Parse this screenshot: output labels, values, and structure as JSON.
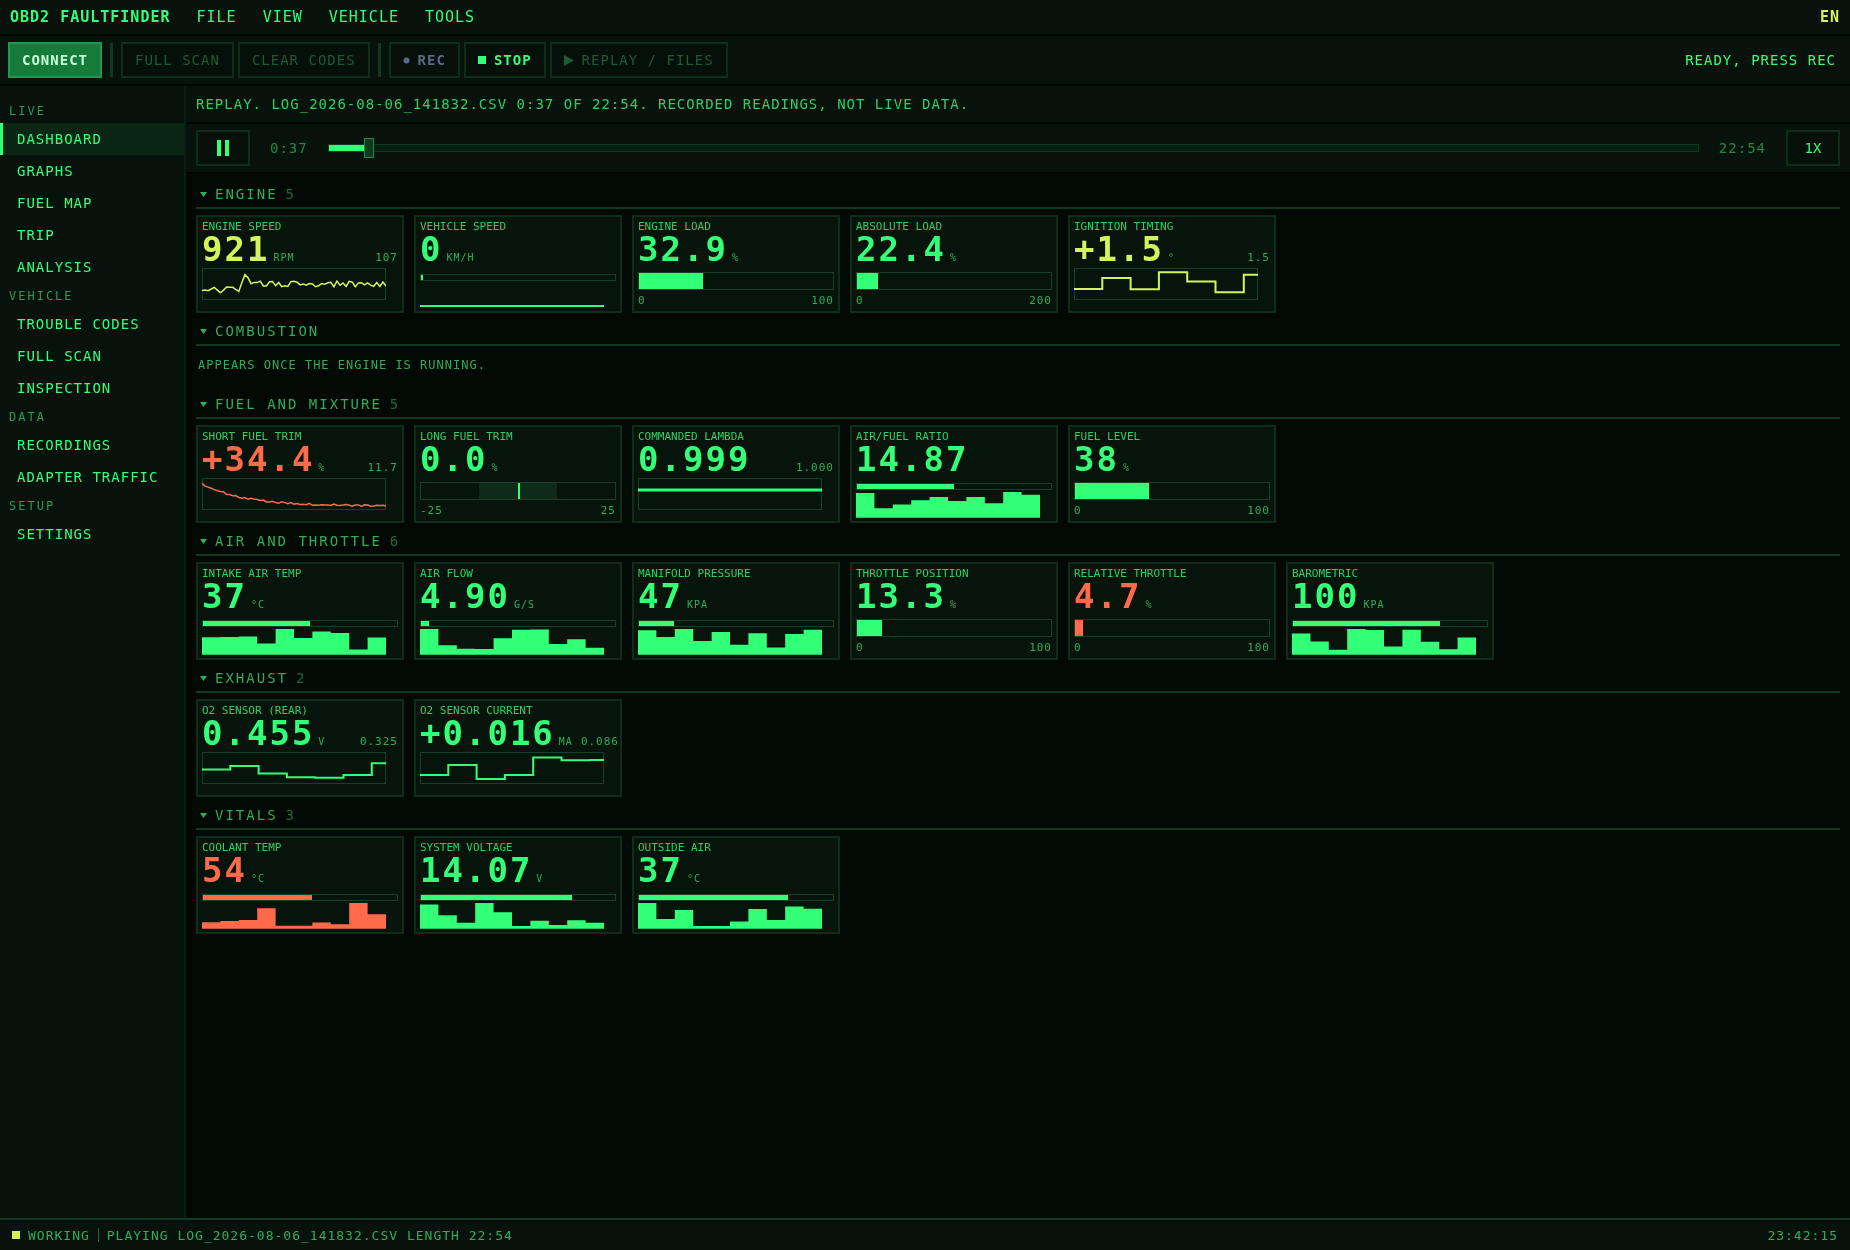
{
  "app": {
    "title": "OBD2 FAULTFINDER",
    "menu": [
      "FILE",
      "VIEW",
      "VEHICLE",
      "TOOLS"
    ],
    "language": "EN"
  },
  "toolbar": {
    "buttons": [
      {
        "label": "CONNECT",
        "kind": "primary",
        "disabled": false
      },
      {
        "label": "FULL SCAN",
        "kind": "plain",
        "disabled": true
      },
      {
        "label": "CLEAR CODES",
        "kind": "plain",
        "disabled": true
      },
      {
        "label": "REC",
        "kind": "record",
        "disabled": false
      },
      {
        "label": "STOP",
        "kind": "stop",
        "disabled": false
      },
      {
        "label": "REPLAY / FILES",
        "kind": "replay",
        "disabled": true
      }
    ],
    "status": "READY, PRESS REC"
  },
  "sidebar": [
    {
      "heading": "LIVE",
      "items": [
        {
          "label": "DASHBOARD",
          "selected": true
        },
        {
          "label": "GRAPHS",
          "selected": false
        },
        {
          "label": "FUEL MAP",
          "selected": false
        },
        {
          "label": "TRIP",
          "selected": false
        },
        {
          "label": "ANALYSIS",
          "selected": false
        }
      ]
    },
    {
      "heading": "VEHICLE",
      "items": [
        {
          "label": "TROUBLE CODES",
          "selected": false
        },
        {
          "label": "FULL SCAN",
          "selected": false
        },
        {
          "label": "INSPECTION",
          "selected": false
        }
      ]
    },
    {
      "heading": "DATA",
      "items": [
        {
          "label": "RECORDINGS",
          "selected": false
        },
        {
          "label": "ADAPTER TRAFFIC",
          "selected": false
        }
      ]
    },
    {
      "heading": "SETUP",
      "items": [
        {
          "label": "SETTINGS",
          "selected": false
        }
      ]
    }
  ],
  "replay": {
    "banner": "REPLAY. LOG_2026-08-06_141832.CSV 0:37 OF 22:54. RECORDED READINGS, NOT LIVE DATA.",
    "playing": true,
    "position": "0:37",
    "level": 0.03,
    "length": "22:54",
    "speed": "1X"
  },
  "sections": [
    {
      "title": "ENGINE",
      "count": "5",
      "expanded": true,
      "cards": [
        {
          "label": "ENGINE SPEED",
          "value": "921",
          "unit": "RPM",
          "color": "#d4f55a",
          "kind": "spark",
          "reading": "107"
        },
        {
          "label": "VEHICLE SPEED",
          "value": "0",
          "unit": "KM/H",
          "color": "#33ff77",
          "kind": "meter",
          "level": 0.01
        },
        {
          "label": "ENGINE LOAD",
          "value": "32.9",
          "unit": "%",
          "color": "#33ff77",
          "kind": "bar",
          "level": 0.33,
          "min": "0",
          "max": "100"
        },
        {
          "label": "ABSOLUTE LOAD",
          "value": "22.4",
          "unit": "%",
          "color": "#33ff77",
          "kind": "bar",
          "level": 0.11,
          "min": "0",
          "max": "200"
        },
        {
          "label": "IGNITION TIMING",
          "value": "+1.5",
          "unit": "°",
          "color": "#d4f55a",
          "kind": "step",
          "reading": "1.5"
        }
      ]
    },
    {
      "title": "COMBUSTION",
      "expanded": true,
      "note": "APPEARS ONCE THE ENGINE IS RUNNING."
    },
    {
      "title": "FUEL AND MIXTURE",
      "count": "5",
      "expanded": true,
      "cards": [
        {
          "label": "SHORT FUEL TRIM",
          "value": "+34.4",
          "unit": "%",
          "color": "#ff6b4a",
          "kind": "decay",
          "reading": "11.7"
        },
        {
          "label": "LONG FUEL TRIM",
          "value": "0.0",
          "unit": "%",
          "color": "#33ff77",
          "kind": "center",
          "level": 0.5,
          "min": "-25",
          "max": "25"
        },
        {
          "label": "COMMANDED LAMBDA",
          "value": "0.999",
          "color": "#33ff77",
          "kind": "flat",
          "reading": "1.000"
        },
        {
          "label": "AIR/FUEL RATIO",
          "value": "14.87",
          "color": "#33ff77",
          "kind": "meter",
          "level": 0.5
        },
        {
          "label": "FUEL LEVEL",
          "value": "38",
          "unit": "%",
          "color": "#33ff77",
          "kind": "bar",
          "level": 0.38,
          "min": "0",
          "max": "100"
        }
      ]
    },
    {
      "title": "AIR AND THROTTLE",
      "count": "6",
      "expanded": true,
      "cards": [
        {
          "label": "INTAKE AIR TEMP",
          "value": "37",
          "unit": "°C",
          "color": "#33ff77",
          "kind": "meter",
          "level": 0.55
        },
        {
          "label": "AIR FLOW",
          "value": "4.90",
          "unit": "G/S",
          "color": "#33ff77",
          "kind": "meter",
          "level": 0.04
        },
        {
          "label": "MANIFOLD PRESSURE",
          "value": "47",
          "unit": "KPA",
          "color": "#33ff77",
          "kind": "meter",
          "level": 0.18
        },
        {
          "label": "THROTTLE POSITION",
          "value": "13.3",
          "unit": "%",
          "color": "#33ff77",
          "kind": "bar",
          "level": 0.13,
          "min": "0",
          "max": "100"
        },
        {
          "label": "RELATIVE THROTTLE",
          "value": "4.7",
          "unit": "%",
          "color": "#ff6b4a",
          "kind": "bar",
          "level": 0.04,
          "min": "0",
          "max": "100"
        },
        {
          "label": "BAROMETRIC",
          "value": "100",
          "unit": "KPA",
          "color": "#33ff77",
          "kind": "meter",
          "level": 0.76
        }
      ]
    },
    {
      "title": "EXHAUST",
      "count": "2",
      "expanded": true,
      "cards": [
        {
          "label": "O2 SENSOR (REAR)",
          "value": "0.455",
          "unit": "V",
          "color": "#33ff77",
          "kind": "step",
          "reading": "0.325"
        },
        {
          "label": "O2 SENSOR CURRENT",
          "value": "+0.016",
          "unit": "MA",
          "color": "#33ff77",
          "kind": "step",
          "reading": "0.086"
        }
      ]
    },
    {
      "title": "VITALS",
      "count": "3",
      "expanded": true,
      "cards": [
        {
          "label": "COOLANT TEMP",
          "value": "54",
          "unit": "°C",
          "color": "#ff6b4a",
          "kind": "meter",
          "level": 0.56
        },
        {
          "label": "SYSTEM VOLTAGE",
          "value": "14.07",
          "unit": "V",
          "color": "#33ff77",
          "kind": "meter",
          "level": 0.78
        },
        {
          "label": "OUTSIDE AIR",
          "value": "37",
          "unit": "°C",
          "color": "#33ff77",
          "kind": "meter",
          "level": 0.77
        }
      ]
    }
  ],
  "status_bar": {
    "state": "WORKING",
    "message": "PLAYING LOG_2026-08-06_141832.CSV LENGTH 22:54",
    "time": "23:42:15"
  }
}
